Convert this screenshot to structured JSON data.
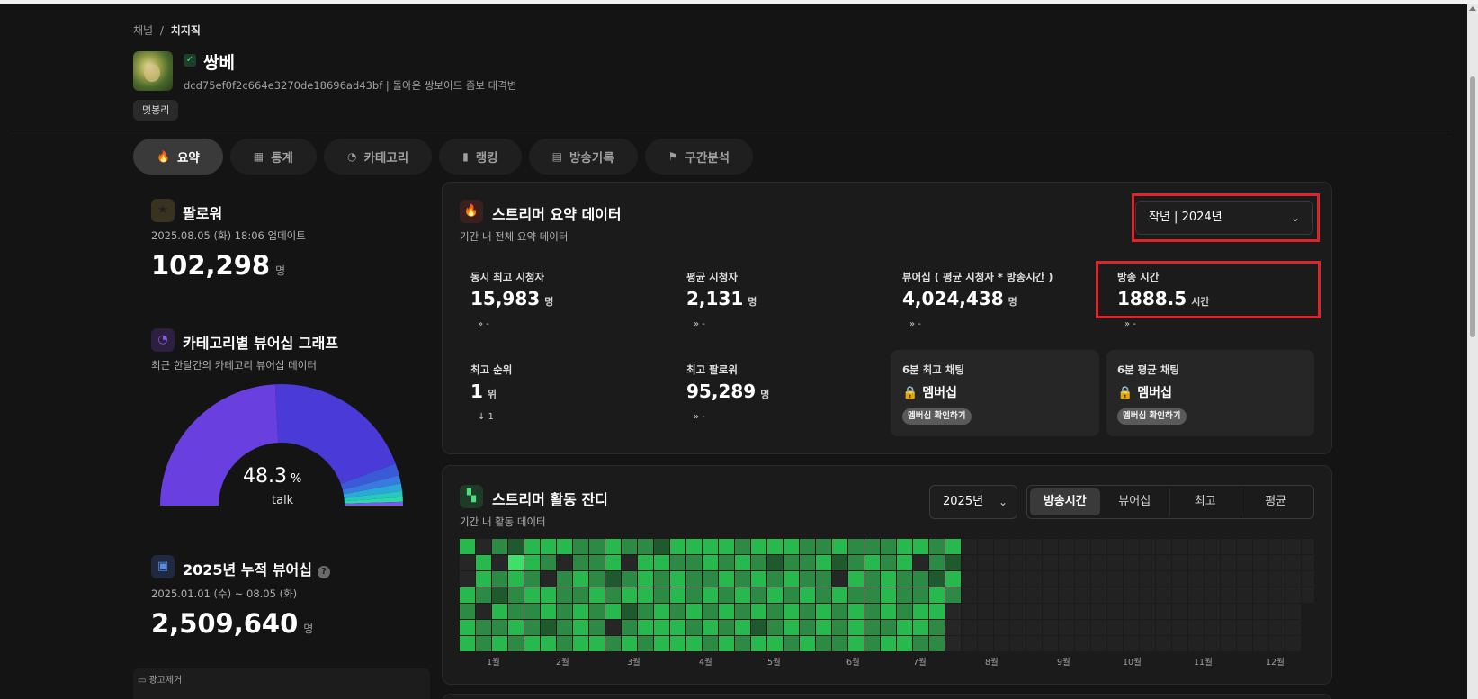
{
  "breadcrumb": {
    "root": "채널",
    "sep": "/",
    "current": "치지직"
  },
  "channel": {
    "name": "쌍베",
    "desc": "dcd75ef0f2c664e3270de18696ad43bf | 돌아온 쌍보이드 좀보 대격변",
    "tag": "멋봉리",
    "verified_icon": "✓"
  },
  "tabs": [
    {
      "label": "요약",
      "icon": "🔥",
      "active": true
    },
    {
      "label": "통계",
      "icon": "▦",
      "active": false
    },
    {
      "label": "카테고리",
      "icon": "◔",
      "active": false
    },
    {
      "label": "랭킹",
      "icon": "▮",
      "active": false
    },
    {
      "label": "방송기록",
      "icon": "▤",
      "active": false
    },
    {
      "label": "구간분석",
      "icon": "⚑",
      "active": false
    }
  ],
  "followers": {
    "title": "팔로워",
    "icon": "★",
    "updated": "2025.08.05 (화) 18:06 업데이트",
    "value": "102,298",
    "unit": "명"
  },
  "category_graph": {
    "title": "카테고리별 뷰어십 그래프",
    "icon": "◔",
    "sub": "최근 한달간의 카테고리 뷰어십 데이터",
    "pct": "48.3",
    "pct_unit": "%",
    "label": "talk",
    "chart_data": {
      "type": "pie",
      "slices": [
        {
          "label": "talk",
          "value": 48.3,
          "color": "#6a3fe0"
        },
        {
          "label": "",
          "value": 40.5,
          "color": "#4a3ad8"
        },
        {
          "label": "",
          "value": 3.2,
          "color": "#3a5ad8"
        },
        {
          "label": "",
          "value": 2.2,
          "color": "#3a7ae0"
        },
        {
          "label": "",
          "value": 2.0,
          "color": "#2aa8d8"
        },
        {
          "label": "",
          "value": 1.6,
          "color": "#28c8c0"
        },
        {
          "label": "",
          "value": 1.2,
          "color": "#30d8a8"
        },
        {
          "label": "",
          "value": 1.0,
          "color": "#7a58e8"
        }
      ]
    }
  },
  "cumulative": {
    "title": "2025년 누적 뷰어십",
    "icon": "▣",
    "help_icon": "?",
    "range": "2025.01.01 (수) ~ 08.05 (화)",
    "value": "2,509,640",
    "unit": "명"
  },
  "ad": {
    "label": "광고제거",
    "icon": "▭"
  },
  "summary": {
    "title": "스트리머 요약 데이터",
    "icon": "🔥",
    "sub": "기간 내 전체 요약 데이터",
    "period_select": "작년 | 2024년",
    "stats": [
      {
        "label": "동시 최고 시청자",
        "value": "15,983",
        "unit": "명",
        "delta": "» -"
      },
      {
        "label": "평균 시청자",
        "value": "2,131",
        "unit": "명",
        "delta": "» -"
      },
      {
        "label": "뷰어십 ( 평균 시청자 * 방송시간 )",
        "value": "4,024,438",
        "unit": "명",
        "delta": "» -"
      },
      {
        "label": "방송 시간",
        "value": "1888.5",
        "unit": "시간",
        "delta": "» -"
      },
      {
        "label": "최고 순위",
        "value": "1",
        "unit": "위",
        "delta": "↓ 1"
      },
      {
        "label": "최고 팔로워",
        "value": "95,289",
        "unit": "명",
        "delta": "» -"
      }
    ],
    "members": [
      {
        "label": "6분 최고 채팅",
        "lock": "🔒 멤버십",
        "button": "멤버십 확인하기"
      },
      {
        "label": "6분 평균 채팅",
        "lock": "🔒 멤버십",
        "button": "멤버십 확인하기"
      }
    ]
  },
  "activity": {
    "title": "스트리머 활동 잔디",
    "icon": "▚",
    "sub": "기간 내 활동 데이터",
    "year_select": "2025년",
    "segments": [
      {
        "label": "방송시간",
        "active": true
      },
      {
        "label": "뷰어십",
        "active": false
      },
      {
        "label": "최고",
        "active": false
      },
      {
        "label": "평균",
        "active": false
      }
    ],
    "months": [
      "1월",
      "2월",
      "3월",
      "4월",
      "5월",
      "6월",
      "7월",
      "8월",
      "9월",
      "10월",
      "11월",
      "12월"
    ],
    "chart_data": {
      "type": "heatmap",
      "rows": 7,
      "cols": 53,
      "active_cols": 31,
      "levels": [
        [
          3,
          0,
          2,
          1,
          3,
          3,
          3,
          2,
          2,
          3,
          2,
          2,
          1,
          3,
          3,
          3,
          3,
          2,
          3,
          3,
          3,
          2,
          2,
          3,
          2,
          2,
          2,
          3,
          3,
          2,
          3
        ],
        [
          0,
          3,
          0,
          4,
          3,
          2,
          0,
          2,
          2,
          3,
          0,
          3,
          3,
          2,
          2,
          3,
          2,
          3,
          2,
          1,
          2,
          2,
          3,
          1,
          2,
          3,
          2,
          3,
          0,
          2,
          1
        ],
        [
          0,
          3,
          2,
          3,
          2,
          0,
          2,
          3,
          2,
          1,
          2,
          3,
          2,
          3,
          2,
          2,
          3,
          2,
          3,
          2,
          3,
          2,
          2,
          0,
          3,
          2,
          3,
          2,
          2,
          1,
          3
        ],
        [
          3,
          2,
          1,
          2,
          3,
          3,
          2,
          2,
          3,
          2,
          3,
          3,
          2,
          3,
          2,
          3,
          2,
          3,
          2,
          3,
          2,
          3,
          2,
          3,
          2,
          2,
          3,
          2,
          2,
          3,
          2
        ],
        [
          2,
          0,
          3,
          2,
          2,
          3,
          2,
          3,
          2,
          3,
          1,
          2,
          3,
          2,
          3,
          2,
          3,
          2,
          3,
          2,
          3,
          2,
          3,
          2,
          3,
          2,
          3,
          2,
          3,
          3,
          0
        ],
        [
          3,
          2,
          2,
          3,
          2,
          1,
          2,
          3,
          2,
          0,
          2,
          3,
          3,
          3,
          2,
          3,
          2,
          3,
          1,
          2,
          3,
          2,
          3,
          2,
          3,
          2,
          2,
          3,
          3,
          2,
          0
        ],
        [
          3,
          2,
          3,
          2,
          3,
          3,
          2,
          3,
          3,
          2,
          3,
          2,
          3,
          3,
          3,
          2,
          3,
          2,
          3,
          3,
          2,
          3,
          2,
          2,
          3,
          2,
          3,
          3,
          2,
          2,
          0
        ]
      ]
    }
  },
  "colors": {
    "accent_red": "#e0222a",
    "heat_empty": "#262626",
    "heat_1": "#1f5a2e",
    "heat_2": "#2d8a45",
    "heat_3": "#28b94e",
    "heat_4": "#3ee06a"
  }
}
